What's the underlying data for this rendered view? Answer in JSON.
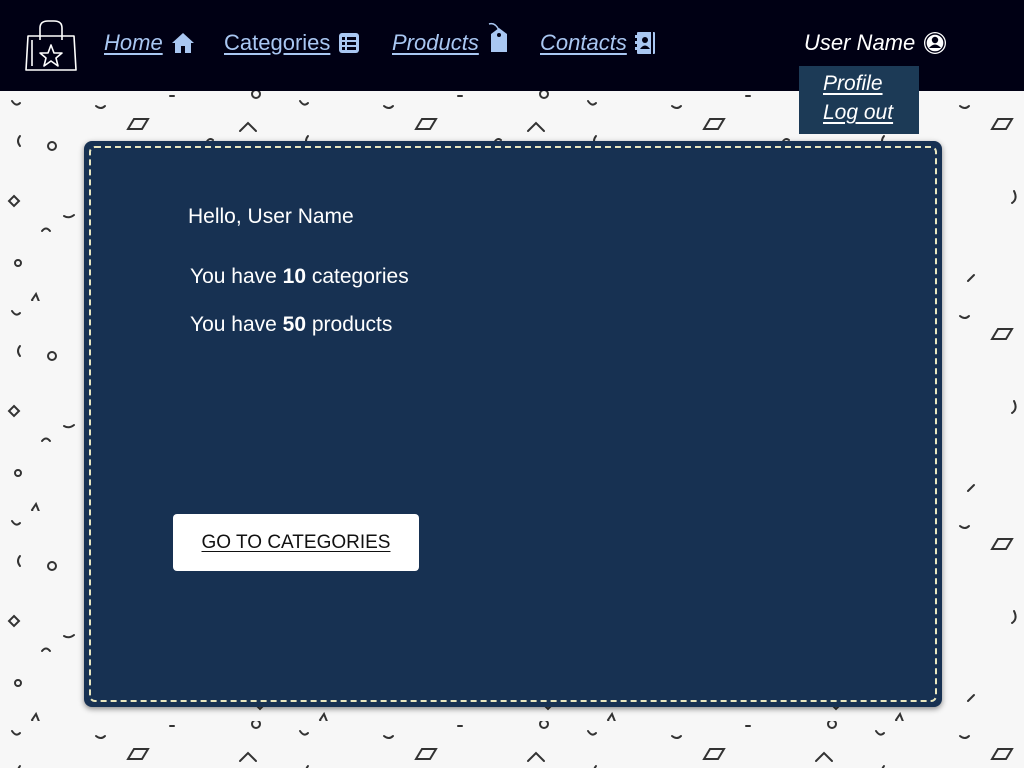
{
  "nav": {
    "home": "Home",
    "categories": "Categories",
    "products": "Products",
    "contacts": "Contacts"
  },
  "user": {
    "name": "User Name",
    "menu": {
      "profile": "Profile",
      "logout": "Log out"
    }
  },
  "dashboard": {
    "greeting": "Hello, User Name",
    "categories_prefix": "You have ",
    "categories_count": "10",
    "categories_suffix": " categories",
    "products_prefix": "You have ",
    "products_count": "50",
    "products_suffix": " products",
    "button_label": "GO TO CATEGORIES"
  },
  "colors": {
    "topbar": "#000014",
    "nav_link": "#a9c7f2",
    "card": "#173152",
    "dropdown": "#1c3a56",
    "card_border": "#e9e7c0",
    "page_bg": "#f7f7f7"
  },
  "icons": {
    "logo": "shopping-bag-star-icon",
    "home": "home-icon",
    "categories": "list-icon",
    "products": "price-tag-icon",
    "contacts": "address-book-icon",
    "user": "user-circle-icon"
  }
}
